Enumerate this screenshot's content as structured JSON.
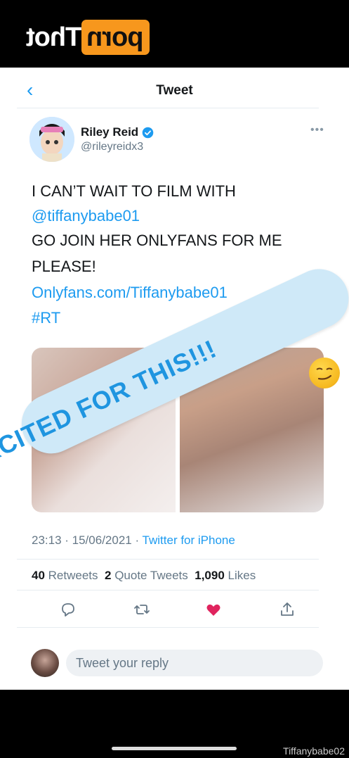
{
  "site_logo": {
    "box_text": "porn",
    "text": "Thot"
  },
  "nav": {
    "title": "Tweet"
  },
  "tweet": {
    "author_name": "Riley Reid",
    "handle": "@rileyreidx3",
    "lines": [
      "I CAN’T WAIT TO FILM WITH",
      "@tiffanybabe01",
      "GO JOIN HER ONLYFANS FOR ME",
      "PLEASE!",
      "Onlyfans.com/Tiffanybabe01",
      "#RT"
    ],
    "timestamp": "23:13 · 15/06/2021 · ",
    "source": "Twitter for iPhone",
    "retweets": "40",
    "retweets_label": "Retweets",
    "quotes": "2",
    "quotes_label": "Quote Tweets",
    "likes": "1,090",
    "likes_label": "Likes"
  },
  "overlay": {
    "text": "SO EXCITED FOR THIS!!!"
  },
  "reply": {
    "placeholder": "Tweet your reply"
  },
  "watermark": "Tiffanybabe02",
  "colors": {
    "accent": "#1d9bf0",
    "like": "#e0245e",
    "logo": "#f7971d"
  }
}
